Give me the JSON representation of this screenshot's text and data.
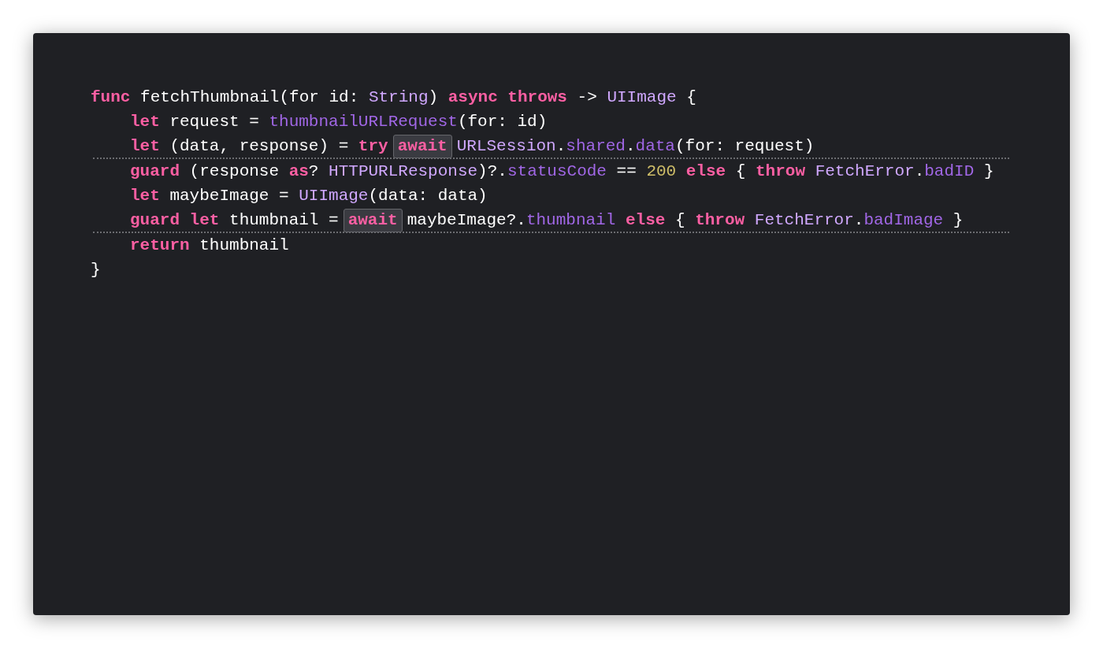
{
  "code_lines": [
    {
      "indented": false,
      "divider_after": false,
      "tokens": [
        {
          "kind": "keyword",
          "text": "func"
        },
        {
          "kind": "plain",
          "text": " fetchThumbnail(for id: "
        },
        {
          "kind": "type",
          "text": "String"
        },
        {
          "kind": "plain",
          "text": ") "
        },
        {
          "kind": "keyword",
          "text": "async throws"
        },
        {
          "kind": "plain",
          "text": " -> "
        },
        {
          "kind": "type",
          "text": "UIImage"
        },
        {
          "kind": "plain",
          "text": " {"
        }
      ]
    },
    {
      "indented": true,
      "divider_after": false,
      "tokens": [
        {
          "kind": "keyword",
          "text": "let"
        },
        {
          "kind": "plain",
          "text": " request = "
        },
        {
          "kind": "member",
          "text": "thumbnailURLRequest"
        },
        {
          "kind": "plain",
          "text": "(for: id)"
        }
      ]
    },
    {
      "indented": true,
      "divider_after": true,
      "tokens": [
        {
          "kind": "keyword",
          "text": "let"
        },
        {
          "kind": "plain",
          "text": " (data, response) = "
        },
        {
          "kind": "keyword",
          "text": "try"
        },
        {
          "kind": "marked",
          "text": "await"
        },
        {
          "kind": "type",
          "text": "URLSession"
        },
        {
          "kind": "plain",
          "text": "."
        },
        {
          "kind": "member",
          "text": "shared"
        },
        {
          "kind": "plain",
          "text": "."
        },
        {
          "kind": "member",
          "text": "data"
        },
        {
          "kind": "plain",
          "text": "(for: request)"
        }
      ]
    },
    {
      "indented": true,
      "divider_after": false,
      "tokens": [
        {
          "kind": "keyword",
          "text": "guard"
        },
        {
          "kind": "plain",
          "text": " (response "
        },
        {
          "kind": "keyword",
          "text": "as"
        },
        {
          "kind": "plain",
          "text": "? "
        },
        {
          "kind": "type",
          "text": "HTTPURLResponse"
        },
        {
          "kind": "plain",
          "text": ")?."
        },
        {
          "kind": "member",
          "text": "statusCode"
        },
        {
          "kind": "plain",
          "text": " == "
        },
        {
          "kind": "number",
          "text": "200"
        },
        {
          "kind": "keyword",
          "text": " else"
        },
        {
          "kind": "plain",
          "text": " { "
        },
        {
          "kind": "keyword",
          "text": "throw"
        },
        {
          "kind": "type",
          "text": " FetchError"
        },
        {
          "kind": "plain",
          "text": "."
        },
        {
          "kind": "member",
          "text": "badID"
        },
        {
          "kind": "plain",
          "text": " }"
        }
      ]
    },
    {
      "indented": true,
      "divider_after": false,
      "tokens": [
        {
          "kind": "keyword",
          "text": "let"
        },
        {
          "kind": "plain",
          "text": " maybeImage = "
        },
        {
          "kind": "type",
          "text": "UIImage"
        },
        {
          "kind": "plain",
          "text": "(data: data)"
        }
      ]
    },
    {
      "indented": true,
      "divider_after": true,
      "tokens": [
        {
          "kind": "keyword",
          "text": "guard let"
        },
        {
          "kind": "plain",
          "text": " thumbnail ="
        },
        {
          "kind": "marked",
          "text": "await"
        },
        {
          "kind": "plain",
          "text": "maybeImage?."
        },
        {
          "kind": "member",
          "text": "thumbnail"
        },
        {
          "kind": "keyword",
          "text": " else"
        },
        {
          "kind": "plain",
          "text": " { "
        },
        {
          "kind": "keyword",
          "text": "throw"
        },
        {
          "kind": "type",
          "text": " FetchError"
        },
        {
          "kind": "plain",
          "text": "."
        },
        {
          "kind": "member",
          "text": "badImage"
        },
        {
          "kind": "plain",
          "text": " }"
        }
      ]
    },
    {
      "indented": true,
      "divider_after": false,
      "tokens": [
        {
          "kind": "keyword",
          "text": "return"
        },
        {
          "kind": "plain",
          "text": " thumbnail"
        }
      ]
    },
    {
      "indented": false,
      "divider_after": false,
      "tokens": [
        {
          "kind": "plain",
          "text": "}"
        }
      ]
    }
  ]
}
